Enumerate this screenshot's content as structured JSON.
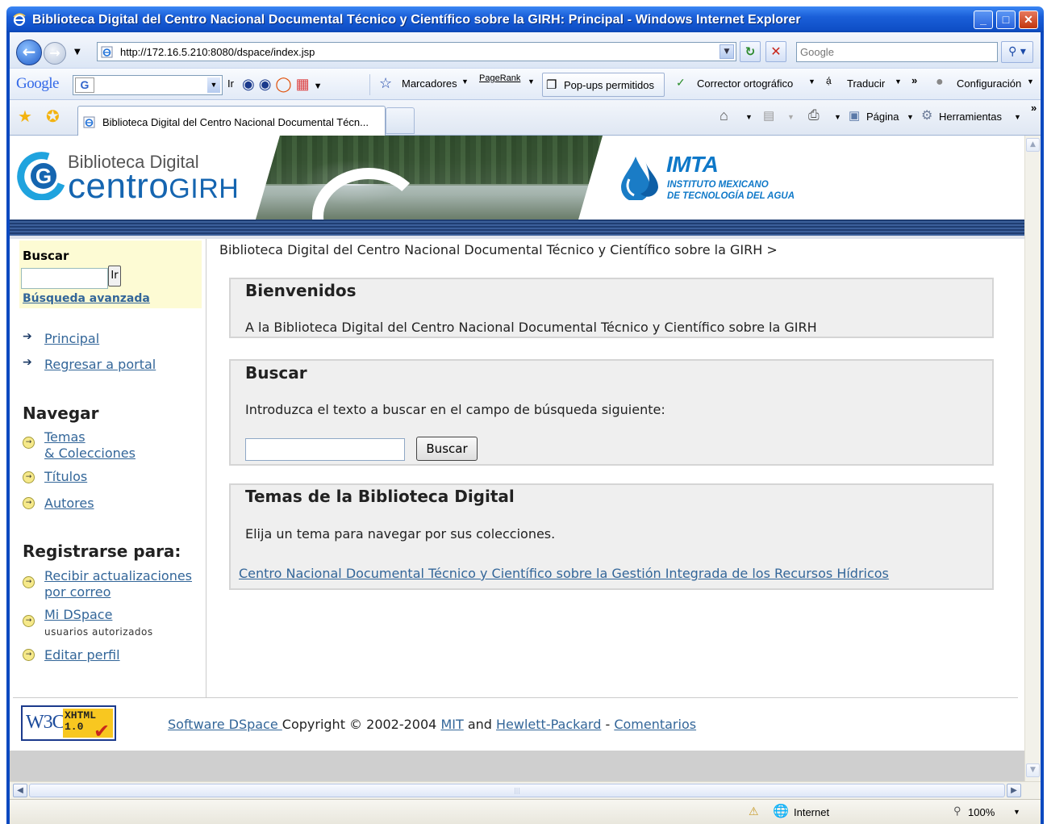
{
  "window": {
    "title": "Biblioteca Digital del Centro Nacional Documental Técnico y Científico sobre la GIRH: Principal - Windows Internet Explorer",
    "minimize": "_",
    "maximize": "□",
    "close": "✕"
  },
  "address_bar": {
    "url": "http://172.16.5.210:8080/dspace/index.jsp",
    "search_placeholder": "Google"
  },
  "google_toolbar": {
    "logo": "Google",
    "go_label": "Ir",
    "bookmarks_label": "Marcadores",
    "pagerank_label": "PageRank",
    "popups_label": "Pop-ups permitidos",
    "spell_label": "Corrector ortográfico",
    "translate_label": "Traducir",
    "more_label": "»",
    "settings_label": "Configuración"
  },
  "tabs": [
    {
      "label": "Biblioteca Digital del Centro Nacional Documental Técn..."
    }
  ],
  "command_bar": {
    "page_label": "Página",
    "tools_label": "Herramientas",
    "more_label": "»"
  },
  "banner": {
    "logo_top": "Biblioteca Digital",
    "logo_main": "centro",
    "logo_suffix": "GIRH",
    "imta_title": "IMTA",
    "imta_line1": "INSTITUTO MEXICANO",
    "imta_line2": "DE TECNOLOGÍA DEL AGUA"
  },
  "sidebar": {
    "search_title": "Buscar",
    "search_button": "Ir",
    "advanced_search": "Búsqueda avanzada",
    "nav_links": [
      "Principal",
      "Regresar a portal"
    ],
    "browse_title": "Navegar",
    "browse_links": [
      "Temas",
      "& Colecciones",
      "Títulos",
      "Autores"
    ],
    "register_title": "Registrarse para:",
    "register_links": [
      "Recibir actualizaciones",
      "por correo",
      "Mi DSpace",
      "usuarios autorizados",
      "Editar perfil"
    ]
  },
  "main": {
    "breadcrumb": "Biblioteca Digital del Centro Nacional Documental Técnico y Científico sobre la GIRH >",
    "welcome_title": "Bienvenidos",
    "welcome_text": "A la Biblioteca Digital del Centro Nacional Documental Técnico y Científico sobre la GIRH",
    "search_title": "Buscar",
    "search_text": "Introduzca el texto a buscar en el campo de búsqueda siguiente:",
    "search_button": "Buscar",
    "topics_title": "Temas de la Biblioteca Digital",
    "topics_text": "Elija un tema para navegar por sus colecciones.",
    "community_link": "Centro Nacional Documental Técnico y Científico sobre la Gestión Integrada de los Recursos Hídricos"
  },
  "footer": {
    "w3c_text": "W3C",
    "xhtml_badge": "XHTML",
    "xhtml_version": "1.0",
    "dspace_link": "Software DSpace ",
    "copyright": "Copyright © 2002-2004 ",
    "mit_link": "MIT",
    "and_text": " and ",
    "hp_link": "Hewlett-Packard",
    "dash_text": " - ",
    "feedback_link": "Comentarios"
  },
  "status_bar": {
    "zone": "Internet",
    "zoom": "100%"
  },
  "colors": {
    "link": "#336699",
    "title_bar": "#0f4fc7",
    "search_panel_bg": "#fdfbd4",
    "box_bg": "#efefef",
    "banner_bar": "#1f3d72"
  }
}
